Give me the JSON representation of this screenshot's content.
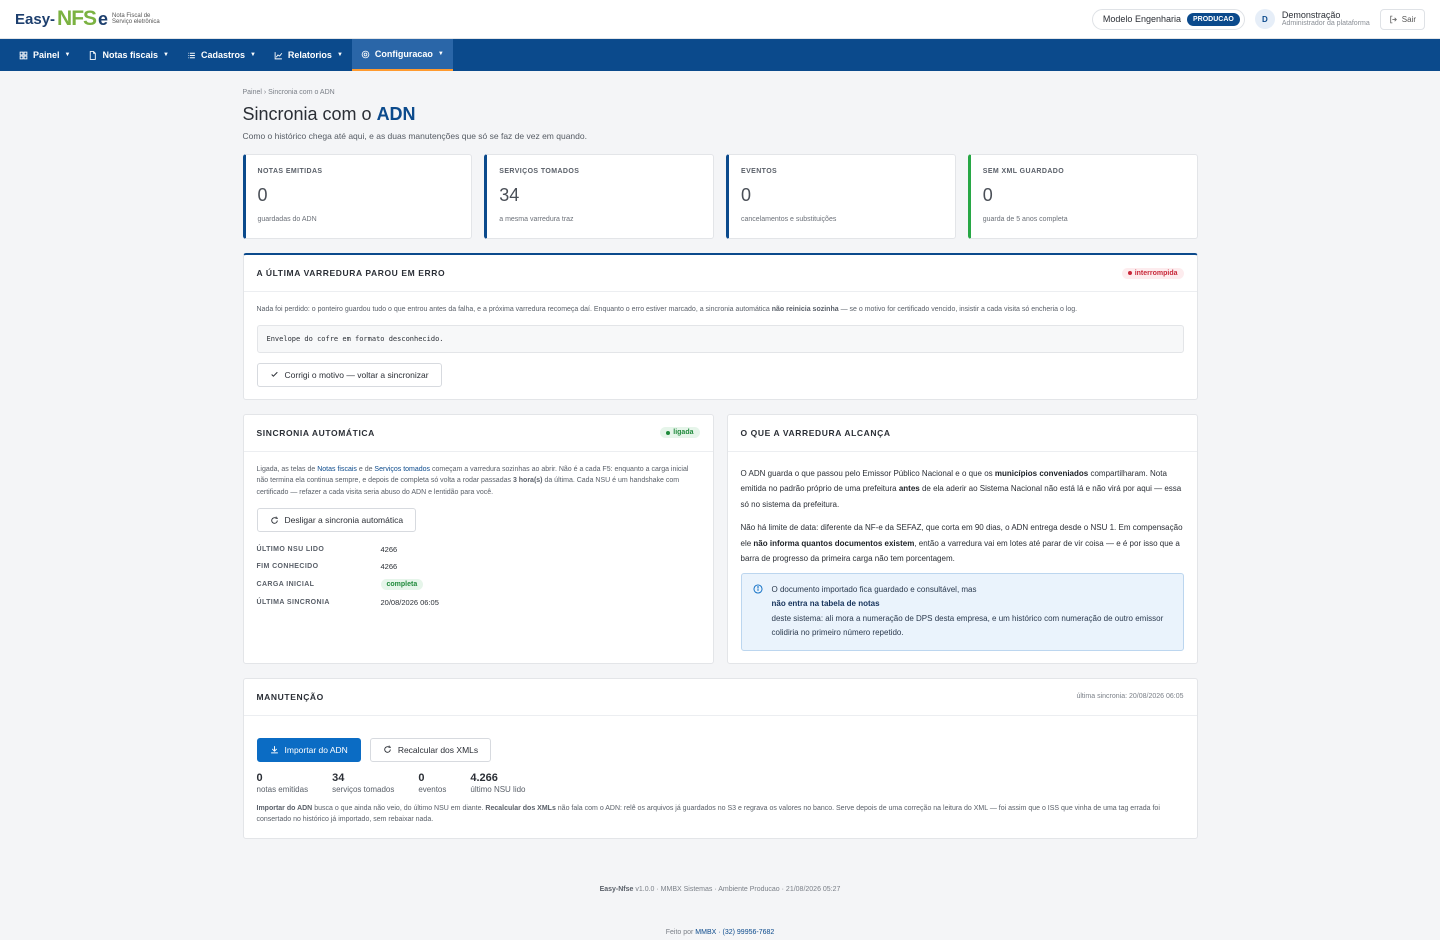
{
  "brand": {
    "logo_easy": "Easy-",
    "logo_nfs": "NFS",
    "logo_e": "e",
    "logo_sub": "Nota Fiscal de Serviço eletrônica"
  },
  "header": {
    "company": "Modelo Engenharia",
    "environment": "PRODUCAO",
    "user_initial": "D",
    "user_name": "Demonstração",
    "user_role": "Administrador da plataforma",
    "logout_label": "Sair"
  },
  "nav": {
    "items": [
      {
        "label": "Painel",
        "icon": "grid-icon"
      },
      {
        "label": "Notas fiscais",
        "icon": "document-icon"
      },
      {
        "label": "Cadastros",
        "icon": "list-icon"
      },
      {
        "label": "Relatorios",
        "icon": "chart-icon"
      },
      {
        "label": "Configuracao",
        "icon": "gear-icon",
        "active": true
      }
    ]
  },
  "breadcrumb": "Painel › Sincronia com o ADN",
  "title": {
    "prefix": "Sincronia com o ",
    "highlight": "ADN"
  },
  "subtitle": "Como o histórico chega até aqui, e as duas manutenções que só se faz de vez em quando.",
  "stats": [
    {
      "label": "NOTAS EMITIDAS",
      "value": "0",
      "note": "guardadas do ADN"
    },
    {
      "label": "SERVIÇOS TOMADOS",
      "value": "34",
      "note": "a mesma varredura traz"
    },
    {
      "label": "EVENTOS",
      "value": "0",
      "note": "cancelamentos e substituições"
    },
    {
      "label": "SEM XML GUARDADO",
      "value": "0",
      "note": "guarda de 5 anos completa"
    }
  ],
  "error_card": {
    "title": "A ÚLTIMA VARREDURA PAROU EM ERRO",
    "badge": "interrompida",
    "text_before": "Nada foi perdido: o ponteiro guardou tudo o que entrou antes da falha, e a próxima varredura recomeça daí. Enquanto o erro estiver marcado, a sincronia automática ",
    "text_bold": "não reinicia sozinha",
    "text_after": " — se o motivo for certificado vencido, insistir a cada visita só encheria o log.",
    "error_message": "Envelope do cofre em formato desconhecido.",
    "button": "Corrigi o motivo — voltar a sincronizar"
  },
  "auto_sync": {
    "title": "SINCRONIA AUTOMÁTICA",
    "badge": "ligada",
    "t1": "Ligada, as telas de ",
    "link1": "Notas fiscais",
    "t2": " e de ",
    "link2": "Serviços tomados",
    "t3": " começam a varredura sozinhas ao abrir. Não é a cada F5: enquanto a carga inicial não termina ela continua sempre, e depois de completa só volta a rodar passadas ",
    "b1": "3 hora(s)",
    "t4": " da última. Cada NSU é um handshake com certificado — refazer a cada visita seria abuso do ADN e lentidão para você.",
    "button": "Desligar a sincronia automática",
    "rows": [
      {
        "label": "ÚLTIMO NSU LIDO",
        "value": "4266"
      },
      {
        "label": "FIM CONHECIDO",
        "value": "4266"
      },
      {
        "label": "CARGA INICIAL",
        "value": "completa",
        "badge": true
      },
      {
        "label": "ÚLTIMA SINCRONIA",
        "value": "20/08/2026 06:05"
      }
    ]
  },
  "scope": {
    "title": "O QUE A VARREDURA ALCANÇA",
    "p1a": "O ADN guarda o que passou pelo Emissor Público Nacional e o que os ",
    "p1b": "municípios conveniados",
    "p1c": " compartilharam. Nota emitida no padrão próprio de uma prefeitura ",
    "p1d": "antes",
    "p1e": " de ela aderir ao Sistema Nacional não está lá e não virá por aqui — essa só no sistema da prefeitura.",
    "p2a": "Não há limite de data: diferente da NF-e da SEFAZ, que corta em 90 dias, o ADN entrega desde o NSU 1. Em compensação ele ",
    "p2b": "não informa quantos documentos existem",
    "p2c": ", então a varredura vai em lotes até parar de vir coisa — e é por isso que a barra de progresso da primeira carga não tem porcentagem.",
    "info_a": "O documento importado fica guardado e consultável, mas",
    "info_b": "não entra na tabela de notas",
    "info_c": "deste sistema: ali mora a numeração de DPS desta empresa, e um histórico com numeração de outro emissor colidiria no primeiro número repetido."
  },
  "maintenance": {
    "title": "MANUTENÇÃO",
    "last_sync": "última sincronia: 20/08/2026 06:05",
    "import_button": "Importar do ADN",
    "recalc_button": "Recalcular dos XMLs",
    "counters": [
      {
        "value": "0",
        "label": "notas emitidas"
      },
      {
        "value": "34",
        "label": "serviços tomados"
      },
      {
        "value": "0",
        "label": "eventos"
      },
      {
        "value": "4.266",
        "label": "último NSU lido"
      }
    ],
    "n1": "Importar do ADN",
    "n2": " busca o que ainda não veio, do último NSU em diante. ",
    "n3": "Recalcular dos XMLs",
    "n4": " não fala com o ADN: relê os arquivos já guardados no S3 e regrava os valores no banco. Serve depois de uma correção na leitura do XML — foi assim que o ISS que vinha de uma tag errada foi consertado no histórico já importado, sem rebaixar nada."
  },
  "footer": {
    "brand": "Easy-Nfse",
    "rest": " v1.0.0 · MMBX Sistemas · Ambiente Producao · 21/08/2026 05:27",
    "made_by": "Feito por ",
    "company": "MMBX",
    "phone": " · (32) 99956-7682"
  },
  "colors": {
    "primary": "#0b4a8c",
    "accent": "#ff9a2e",
    "success": "#27a745",
    "danger": "#c8283a"
  }
}
